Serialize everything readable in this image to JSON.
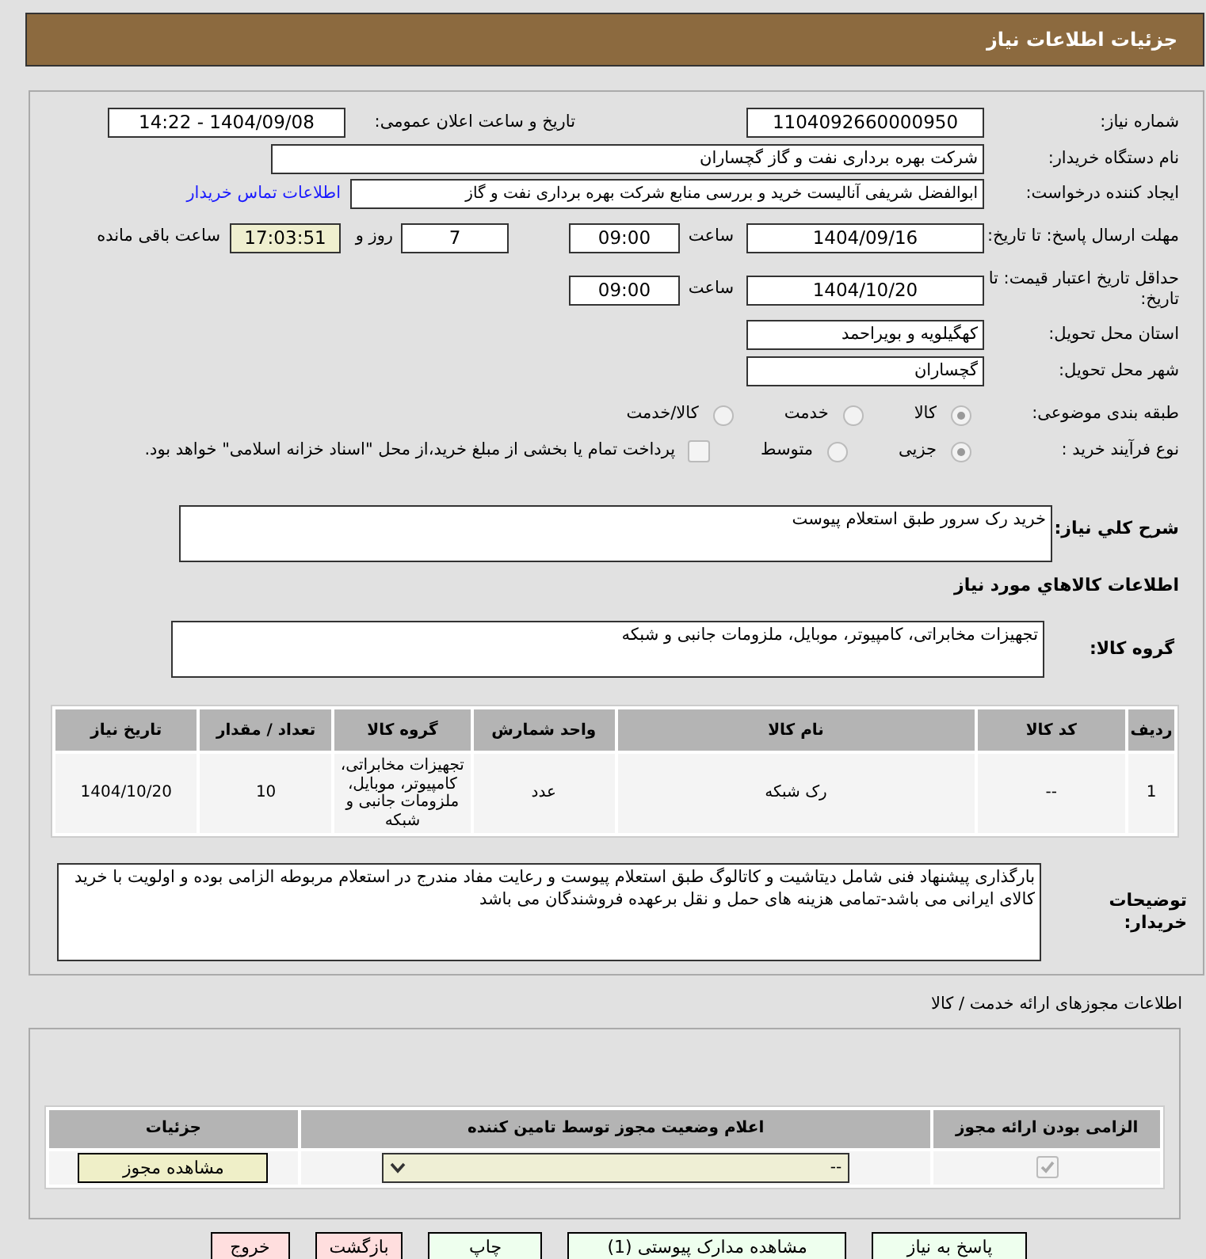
{
  "header": {
    "title": "جزئیات اطلاعات نیاز"
  },
  "details": {
    "need_number": {
      "label": "شماره نیاز:",
      "value": "1104092660000950"
    },
    "announce_datetime": {
      "label": "تاریخ و ساعت اعلان عمومی:",
      "value": "1404/09/08 - 14:22"
    },
    "buyer_org": {
      "label": "نام دستگاه خریدار:",
      "value": "شرکت بهره برداری نفت و گاز گچساران"
    },
    "requester": {
      "label": "ایجاد کننده درخواست:",
      "value": "ابوالفضل شریفی آنالیست خرید و بررسی منابع شرکت بهره برداری نفت و گاز",
      "link": "اطلاعات تماس خریدار"
    },
    "reply_deadline": {
      "label": "مهلت ارسال پاسخ: تا تاریخ:",
      "date": "1404/09/16",
      "time_label": "ساعت",
      "time": "09:00",
      "days": "7",
      "days_label": "روز و",
      "remaining": "17:03:51",
      "remaining_label": "ساعت باقی مانده"
    },
    "price_validity": {
      "label": "حداقل تاریخ اعتبار قیمت: تا تاریخ:",
      "date": "1404/10/20",
      "time_label": "ساعت",
      "time": "09:00"
    },
    "province": {
      "label": "استان محل تحویل:",
      "value": "کهگیلویه و بویراحمد"
    },
    "city": {
      "label": "شهر محل تحویل:",
      "value": "گچساران"
    },
    "category": {
      "label": "طبقه بندی موضوعی:",
      "disabled": true,
      "options": [
        {
          "label": "کالا",
          "selected": true
        },
        {
          "label": "خدمت",
          "selected": false
        },
        {
          "label": "کالا/خدمت",
          "selected": false
        }
      ]
    },
    "process": {
      "label": "نوع فرآیند خرید :",
      "disabled": true,
      "options": [
        {
          "label": "جزیی",
          "selected": true
        },
        {
          "label": "متوسط",
          "selected": false
        }
      ],
      "payment_note": {
        "label": "پرداخت تمام یا بخشی از مبلغ خرید،از محل \"اسناد خزانه اسلامی\" خواهد بود.",
        "checked": false
      }
    },
    "summary": {
      "label": "شرح کلي نياز:",
      "value": "خرید رک سرور طبق استعلام پیوست"
    }
  },
  "goods": {
    "title": "اطلاعات کالاهاي مورد نياز",
    "group_label": "گروه کالا:",
    "group": "تجهیزات مخابراتی، کامپیوتر، موبایل، ملزومات جانبی و شبکه",
    "table": {
      "columns": [
        "ردیف",
        "کد کالا",
        "نام کالا",
        "واحد شمارش",
        "گروه کالا",
        "تعداد / مقدار",
        "تاریخ نیاز"
      ],
      "rows": [
        [
          "1",
          "--",
          "رک شبکه",
          "عدد",
          "تجهیزات مخابراتی، کامپیوتر، موبایل، ملزومات جانبی و شبکه",
          "10",
          "1404/10/20"
        ]
      ]
    },
    "notes_label": "توضیحات خریدار:",
    "notes": "بارگذاری پیشنهاد فنی شامل دیتاشیت و کاتالوگ طبق استعلام پیوست و رعایت مفاد مندرج در استعلام مربوطه الزامی بوده و اولویت با خرید کالای ایرانی می باشد-تمامی هزینه های حمل و نقل برعهده فروشندگان می باشد"
  },
  "licenses": {
    "title": "اطلاعات مجوزهای ارائه خدمت / کالا",
    "columns": [
      "الزامی بودن ارائه مجوز",
      "اعلام وضعیت مجوز توسط تامین کننده",
      "جزئیات"
    ],
    "rows": [
      {
        "required": true,
        "disabled": true,
        "status": "--",
        "button": "مشاهده مجوز"
      }
    ]
  },
  "buttons": [
    {
      "label": "پاسخ به نیاز",
      "kind": "primary"
    },
    {
      "label": "مشاهده مدارک پیوستی (1)",
      "kind": "primary"
    },
    {
      "label": "چاپ",
      "kind": "primary"
    },
    {
      "label": "بازگشت",
      "kind": "danger"
    },
    {
      "label": "خروج",
      "kind": "danger"
    }
  ]
}
